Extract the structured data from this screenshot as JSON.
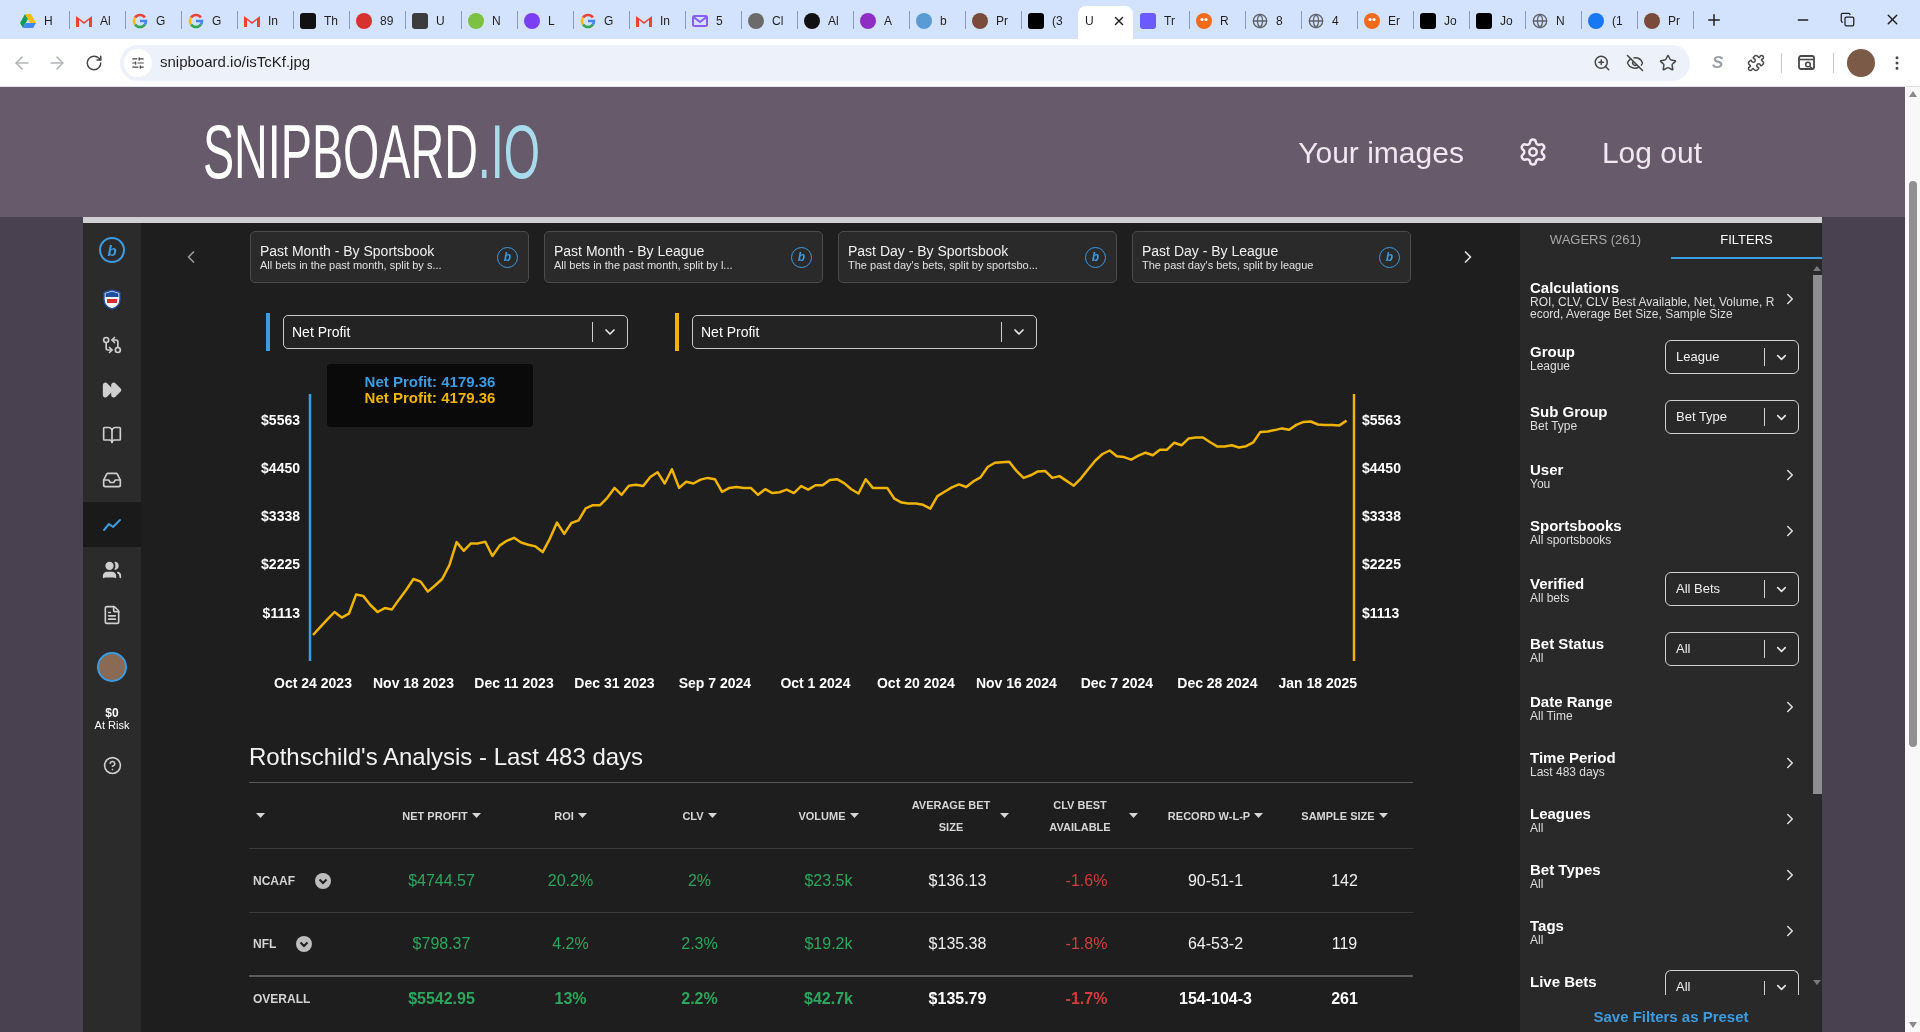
{
  "browser": {
    "tabs": [
      {
        "title": "H",
        "kind": "drive",
        "selected": false
      },
      {
        "title": "Al",
        "kind": "gmail",
        "selected": false
      },
      {
        "title": "G",
        "kind": "google",
        "selected": false
      },
      {
        "title": "G",
        "kind": "google",
        "selected": false
      },
      {
        "title": "In",
        "kind": "gmail",
        "selected": false
      },
      {
        "title": "Th",
        "kind": "tile",
        "color": "#111111",
        "selected": false
      },
      {
        "title": "89",
        "kind": "disc",
        "color": "#d8322f",
        "selected": false
      },
      {
        "title": "U",
        "kind": "tile",
        "color": "#3c3c3c",
        "selected": false
      },
      {
        "title": "N",
        "kind": "disc",
        "color": "#7cc242",
        "selected": false
      },
      {
        "title": "L",
        "kind": "disc",
        "color": "#7a3ff2",
        "selected": false
      },
      {
        "title": "G",
        "kind": "google",
        "selected": false
      },
      {
        "title": "In",
        "kind": "gmail",
        "selected": false
      },
      {
        "title": "5",
        "kind": "envelope",
        "color": "#8b5cf6",
        "selected": false
      },
      {
        "title": "Cl",
        "kind": "disc",
        "color": "#6b6b6b",
        "selected": false
      },
      {
        "title": "Al",
        "kind": "disc",
        "color": "#111111",
        "selected": false
      },
      {
        "title": "A",
        "kind": "disc",
        "color": "#8e2ec4",
        "selected": false
      },
      {
        "title": "b",
        "kind": "disc",
        "color": "#5b9bd5",
        "selected": false
      },
      {
        "title": "Pr",
        "kind": "disc",
        "color": "#7a4a3a",
        "selected": false
      },
      {
        "title": "(3",
        "kind": "tile",
        "color": "#000000",
        "selected": false
      },
      {
        "title": "U",
        "kind": "none",
        "selected": true
      },
      {
        "title": "Tr",
        "kind": "tile",
        "color": "#6b5bff",
        "selected": false
      },
      {
        "title": "R",
        "kind": "bird",
        "color": "#f26b1d",
        "selected": false
      },
      {
        "title": "8",
        "kind": "globe",
        "selected": false
      },
      {
        "title": "4",
        "kind": "globe",
        "selected": false
      },
      {
        "title": "Er",
        "kind": "bird",
        "color": "#f26b1d",
        "selected": false
      },
      {
        "title": "Jo",
        "kind": "tile",
        "color": "#000000",
        "selected": false
      },
      {
        "title": "Jo",
        "kind": "tile",
        "color": "#000000",
        "selected": false
      },
      {
        "title": "N",
        "kind": "globe",
        "selected": false
      },
      {
        "title": "(1",
        "kind": "disc",
        "color": "#1877f2",
        "selected": false
      },
      {
        "title": "Pr",
        "kind": "disc",
        "color": "#7a4a3a",
        "selected": false
      }
    ],
    "address": "snipboard.io/isTcKf.jpg",
    "extension_label": "S"
  },
  "site_header": {
    "logo": "SNIPBOARD",
    "logo_suffix": ".IO",
    "links": [
      "Your images",
      "Log out"
    ]
  },
  "app": {
    "sidebar": {
      "logo": "b",
      "items": [
        {
          "selected": false
        },
        {
          "selected": false
        },
        {
          "selected": false
        },
        {
          "selected": false
        },
        {
          "selected": false
        },
        {
          "selected": true
        },
        {
          "selected": false
        },
        {
          "selected": false
        }
      ],
      "risk": {
        "amount": "$0",
        "label": "At Risk"
      }
    },
    "presets": [
      {
        "title": "Past Month - By Sportsbook",
        "description": "All bets in the past month, split by s...",
        "mark": "b"
      },
      {
        "title": "Past Month - By League",
        "description": "All bets in the past month, split by l...",
        "mark": "b"
      },
      {
        "title": "Past Day - By Sportsbook",
        "description": "The past day's bets, split by sportsbo...",
        "mark": "b"
      },
      {
        "title": "Past Day - By League",
        "description": "The past day's bets, split by league",
        "mark": "b"
      }
    ],
    "metrics": [
      {
        "value": "Net Profit",
        "color": "#3d9be0"
      },
      {
        "value": "Net Profit",
        "color": "#f0b400"
      }
    ],
    "chart": {
      "tooltip": [
        {
          "text": "Net Profit: 4179.36",
          "color": "#3d9be0"
        },
        {
          "text": "Net Profit: 4179.36",
          "color": "#f0b400"
        }
      ],
      "chart_data": {
        "type": "line",
        "categories": [
          "Oct 24 2023",
          null,
          null,
          null,
          null,
          null,
          null,
          null,
          null,
          null,
          null,
          null,
          null,
          null,
          "Nov 18 2023",
          null,
          null,
          null,
          null,
          null,
          null,
          null,
          null,
          null,
          null,
          null,
          null,
          null,
          "Dec 11 2023",
          null,
          null,
          null,
          null,
          null,
          null,
          null,
          null,
          null,
          null,
          null,
          null,
          null,
          "Dec 31 2023",
          null,
          null,
          null,
          null,
          null,
          null,
          null,
          null,
          null,
          null,
          null,
          null,
          null,
          "Sep 7 2024",
          null,
          null,
          null,
          null,
          null,
          null,
          null,
          null,
          null,
          null,
          null,
          null,
          null,
          "Oct 1 2024",
          null,
          null,
          null,
          null,
          null,
          null,
          null,
          null,
          null,
          null,
          null,
          null,
          null,
          "Oct 20 2024",
          null,
          null,
          null,
          null,
          null,
          null,
          null,
          null,
          null,
          null,
          null,
          null,
          null,
          "Nov 16 2024",
          null,
          null,
          null,
          null,
          null,
          null,
          null,
          null,
          null,
          null,
          null,
          null,
          null,
          "Dec 7 2024",
          null,
          null,
          null,
          null,
          null,
          null,
          null,
          null,
          null,
          null,
          null,
          null,
          null,
          "Dec 28 2024",
          null,
          null,
          null,
          null,
          null,
          null,
          null,
          null,
          null,
          null,
          null,
          null,
          null,
          "Jan 18 2025",
          null,
          null,
          null,
          null
        ],
        "series": [
          {
            "color": "#f0b400",
            "values": [
              600,
              780,
              960,
              1130,
              1000,
              1090,
              1530,
              1500,
              1290,
              1130,
              1220,
              1190,
              1420,
              1640,
              1890,
              1830,
              1600,
              1740,
              1890,
              2210,
              2740,
              2540,
              2710,
              2710,
              2750,
              2420,
              2660,
              2770,
              2840,
              2730,
              2680,
              2640,
              2510,
              2820,
              3190,
              2930,
              3180,
              3240,
              3520,
              3590,
              3590,
              3760,
              3990,
              3830,
              4040,
              4060,
              4030,
              4240,
              4350,
              4090,
              4420,
              3990,
              4130,
              4090,
              4180,
              4220,
              4190,
              3900,
              3990,
              4010,
              3990,
              3990,
              3830,
              3960,
              3870,
              3890,
              3950,
              3870,
              4030,
              3950,
              4050,
              4050,
              4170,
              4190,
              4100,
              3960,
              3860,
              4190,
              3990,
              3990,
              3990,
              3740,
              3650,
              3630,
              3630,
              3600,
              3510,
              3800,
              3900,
              4000,
              4070,
              4010,
              4140,
              4230,
              4470,
              4570,
              4580,
              4590,
              4380,
              4220,
              4280,
              4370,
              4380,
              4220,
              4260,
              4150,
              4040,
              4210,
              4420,
              4620,
              4770,
              4850,
              4720,
              4700,
              4640,
              4730,
              4800,
              4740,
              4870,
              4870,
              5030,
              4970,
              5130,
              5150,
              5150,
              5040,
              4940,
              4940,
              4970,
              4920,
              4950,
              5040,
              5280,
              5290,
              5320,
              5360,
              5330,
              5440,
              5510,
              5520,
              5450,
              5440,
              5440,
              5430,
              5540
            ]
          }
        ],
        "ylim": [
          0,
          6153
        ],
        "yticks": [
          {
            "value": 1113,
            "label": "$1113"
          },
          {
            "value": 2225,
            "label": "$2225"
          },
          {
            "value": 3338,
            "label": "$3338"
          },
          {
            "value": 4450,
            "label": "$4450"
          },
          {
            "value": 5563,
            "label": "$5563"
          }
        ]
      }
    },
    "analysis": {
      "title": "Rothschild's Analysis - Last 483 days",
      "columns": [
        "NET PROFIT",
        "ROI",
        "CLV",
        "VOLUME",
        "AVERAGE BET SIZE",
        "CLV BEST AVAILABLE",
        "RECORD W-L-P",
        "SAMPLE SIZE"
      ],
      "rows": [
        {
          "label": "NCAAF",
          "kind": "group",
          "cells": [
            {
              "text": "$4744.57",
              "color": "#2ea55e"
            },
            {
              "text": "20.2%",
              "color": "#2ea55e"
            },
            {
              "text": "2%",
              "color": "#2ea55e"
            },
            {
              "text": "$23.5k",
              "color": "#2ea55e"
            },
            {
              "text": "$136.13"
            },
            {
              "text": "-1.6%",
              "color": "#d23c3c"
            },
            {
              "text": "90-51-1"
            },
            {
              "text": "142"
            }
          ]
        },
        {
          "label": "NFL",
          "kind": "group",
          "cells": [
            {
              "text": "$798.37",
              "color": "#2ea55e"
            },
            {
              "text": "4.2%",
              "color": "#2ea55e"
            },
            {
              "text": "2.3%",
              "color": "#2ea55e"
            },
            {
              "text": "$19.2k",
              "color": "#2ea55e"
            },
            {
              "text": "$135.38"
            },
            {
              "text": "-1.8%",
              "color": "#d23c3c"
            },
            {
              "text": "64-53-2"
            },
            {
              "text": "119"
            }
          ]
        },
        {
          "label": "OVERALL",
          "kind": "total",
          "cells": [
            {
              "text": "$5542.95",
              "color": "#2ea55e"
            },
            {
              "text": "13%",
              "color": "#2ea55e"
            },
            {
              "text": "2.2%",
              "color": "#2ea55e"
            },
            {
              "text": "$42.7k",
              "color": "#2ea55e"
            },
            {
              "text": "$135.79"
            },
            {
              "text": "-1.7%",
              "color": "#d23c3c"
            },
            {
              "text": "154-104-3"
            },
            {
              "text": "261"
            }
          ]
        }
      ]
    },
    "panel": {
      "tabs": [
        {
          "label": "WAGERS (261)",
          "selected": false
        },
        {
          "label": "FILTERS",
          "selected": true
        }
      ],
      "filters": [
        {
          "kind": "link",
          "title": "Calculations",
          "summary": "ROI, CLV, CLV Best Available, Net, Volume, Record, Average Bet Size, Sample Size"
        },
        {
          "kind": "select",
          "title": "Group",
          "summary": "League",
          "value": "League"
        },
        {
          "kind": "select",
          "title": "Sub Group",
          "summary": "Bet Type",
          "value": "Bet Type"
        },
        {
          "kind": "link",
          "title": "User",
          "summary": "You"
        },
        {
          "kind": "link",
          "title": "Sportsbooks",
          "summary": "All sportsbooks"
        },
        {
          "kind": "select",
          "title": "Verified",
          "summary": "All bets",
          "value": "All Bets"
        },
        {
          "kind": "select",
          "title": "Bet Status",
          "summary": "All",
          "value": "All"
        },
        {
          "kind": "link",
          "title": "Date Range",
          "summary": "All Time"
        },
        {
          "kind": "link",
          "title": "Time Period",
          "summary": "Last 483 days"
        },
        {
          "kind": "link",
          "title": "Leagues",
          "summary": "All"
        },
        {
          "kind": "link",
          "title": "Bet Types",
          "summary": "All"
        },
        {
          "kind": "link",
          "title": "Tags",
          "summary": "All"
        },
        {
          "kind": "select",
          "title": "Live Bets",
          "value": "All"
        }
      ],
      "save_label": "Save Filters as Preset"
    }
  }
}
